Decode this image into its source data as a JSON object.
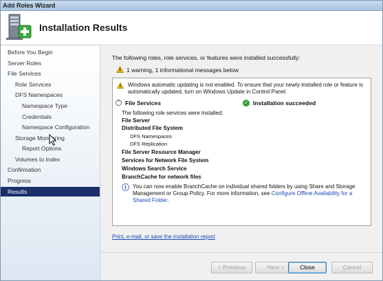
{
  "window": {
    "title": "Add Roles Wizard"
  },
  "header": {
    "title": "Installation Results",
    "icon": "server-roles-icon"
  },
  "sidebar": {
    "items": [
      {
        "label": "Before You Begin",
        "level": 0,
        "selected": false
      },
      {
        "label": "Server Roles",
        "level": 0,
        "selected": false
      },
      {
        "label": "File Services",
        "level": 0,
        "selected": false
      },
      {
        "label": "Role Services",
        "level": 1,
        "selected": false
      },
      {
        "label": "DFS Namespaces",
        "level": 1,
        "selected": false
      },
      {
        "label": "Namespace Type",
        "level": 2,
        "selected": false
      },
      {
        "label": "Credentials",
        "level": 2,
        "selected": false
      },
      {
        "label": "Namespace Configuration",
        "level": 2,
        "selected": false
      },
      {
        "label": "Storage Monitoring",
        "level": 1,
        "selected": false
      },
      {
        "label": "Report Options",
        "level": 2,
        "selected": false
      },
      {
        "label": "Volumes to Index",
        "level": 1,
        "selected": false
      },
      {
        "label": "Confirmation",
        "level": 0,
        "selected": false
      },
      {
        "label": "Progress",
        "level": 0,
        "selected": false
      },
      {
        "label": "Results",
        "level": 0,
        "selected": true
      }
    ]
  },
  "main": {
    "intro": "The following roles, role services, or features were installed successfully:",
    "warning_summary": "1 warning, 1 informational messages below",
    "warning_message": "Windows automatic updating is not enabled. To ensure that your newly-installed role or feature is automatically updated, turn on Windows Update in Control Panel.",
    "section": {
      "label": "File Services",
      "status": "Installation succeeded",
      "roles_intro": "The following role services were installed:",
      "roles": [
        {
          "label": "File Server",
          "style": "bold"
        },
        {
          "label": "Distributed File System",
          "style": "bold"
        },
        {
          "label": "DFS Namespaces",
          "style": "sub"
        },
        {
          "label": "DFS Replication",
          "style": "sub"
        },
        {
          "label": "File Server Resource Manager",
          "style": "bold"
        },
        {
          "label": "Services for Network File System",
          "style": "bold"
        },
        {
          "label": "Windows Search Service",
          "style": "bold"
        },
        {
          "label": "BranchCache for network files",
          "style": "bold"
        }
      ],
      "info_text": "You can now enable BranchCache on individual shared folders by using Share and Storage Management or Group Policy. For more information, see ",
      "info_link": "Configure Offline Availability for a Shared Folder",
      "info_end": "."
    },
    "report_link": "Print, e-mail, or save the installation report"
  },
  "footer": {
    "previous_label": "< Previous",
    "next_label": "Next >",
    "close_label": "Close",
    "cancel_label": "Cancel"
  }
}
